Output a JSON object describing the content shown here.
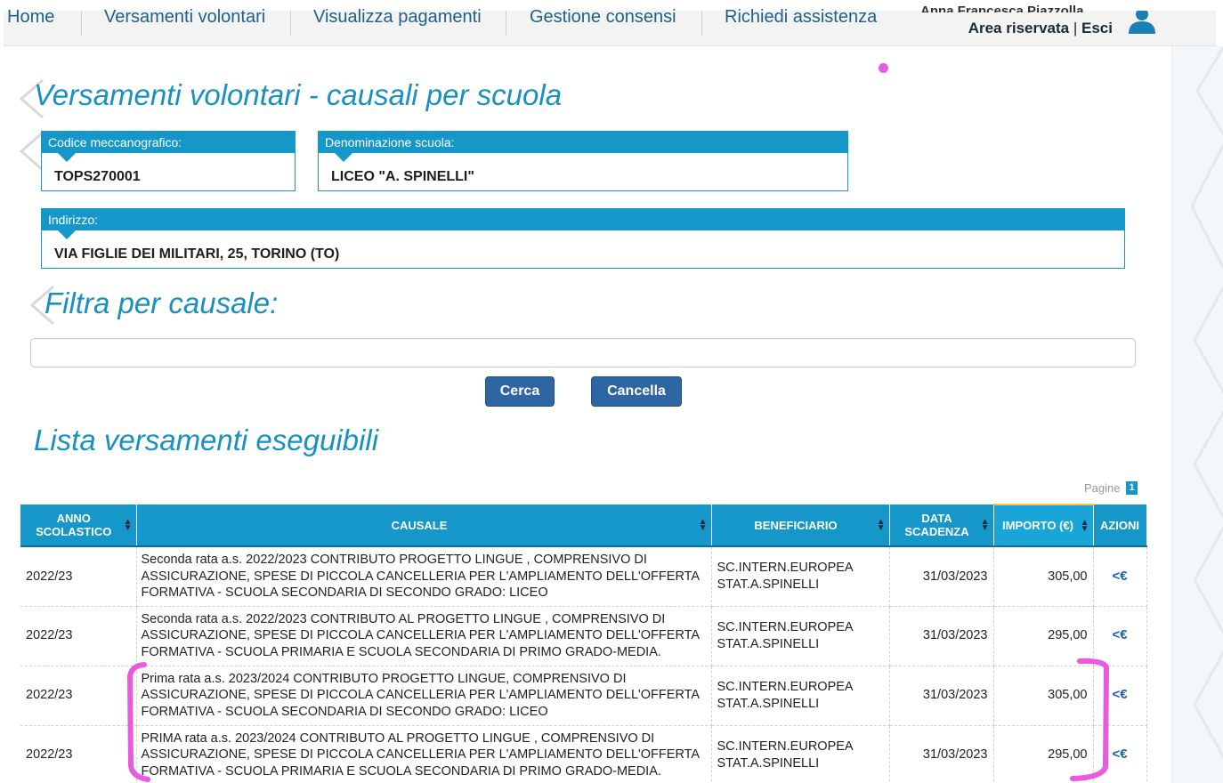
{
  "nav": {
    "items": [
      "Home",
      "Versamenti volontari",
      "Visualizza pagamenti",
      "Gestione consensi",
      "Richiedi assistenza"
    ],
    "user_name": "Anna Francesca Piazzolla",
    "area_riservata": "Area riservata",
    "separator": "|",
    "logout": "Esci"
  },
  "page": {
    "title": "Versamenti volontari - causali per scuola",
    "filter_title": "Filtra per causale:",
    "list_title": "Lista versamenti eseguibili"
  },
  "school": {
    "code_label": "Codice meccanografico:",
    "code_value": "TOPS270001",
    "name_label": "Denominazione scuola:",
    "name_value": "LICEO \"A. SPINELLI\"",
    "address_label": "Indirizzo:",
    "address_value": "VIA FIGLIE DEI MILITARI, 25, TORINO (TO)"
  },
  "filter": {
    "value": "",
    "placeholder": ""
  },
  "buttons": {
    "search": "Cerca",
    "cancel": "Cancella"
  },
  "pagination": {
    "label": "Pagine",
    "current": "1"
  },
  "table": {
    "headers": {
      "anno": [
        "ANNO",
        "SCOLASTICO"
      ],
      "causale": "CAUSALE",
      "beneficiario": "BENEFICIARIO",
      "scadenza": [
        "DATA",
        "SCADENZA"
      ],
      "importo": "IMPORTO (€)",
      "azioni": "AZIONI"
    },
    "rows": [
      {
        "anno": "2022/23",
        "causale": [
          "Seconda rata a.s. 2022/2023 CONTRIBUTO PROGETTO LINGUE , COMPRENSIVO DI",
          "ASSICURAZIONE, SPESE DI PICCOLA CANCELLERIA PER L'AMPLIAMENTO DELL'OFFERTA",
          "FORMATIVA - SCUOLA SECONDARIA DI SECONDO GRADO: LICEO"
        ],
        "beneficiario": [
          "SC.INTERN.EUROPEA",
          "STAT.A.SPINELLI"
        ],
        "scadenza": "31/03/2023",
        "importo": "305,00",
        "azione": "<€"
      },
      {
        "anno": "2022/23",
        "causale": [
          "Seconda rata a.s. 2022/2023 CONTRIBUTO AL PROGETTO LINGUE , COMPRENSIVO DI",
          "ASSICURAZIONE, SPESE DI PICCOLA CANCELLERIA PER L'AMPLIAMENTO DELL'OFFERTA",
          "FORMATIVA - SCUOLA PRIMARIA E SCUOLA SECONDARIA DI PRIMO GRADO-MEDIA."
        ],
        "beneficiario": [
          "SC.INTERN.EUROPEA",
          "STAT.A.SPINELLI"
        ],
        "scadenza": "31/03/2023",
        "importo": "295,00",
        "azione": "<€"
      },
      {
        "anno": "2022/23",
        "causale": [
          "Prima rata a.s. 2023/2024 CONTRIBUTO PROGETTO LINGUE, COMPRENSIVO DI",
          "ASSICURAZIONE, SPESE DI PICCOLA CANCELLERIA PER L'AMPLIAMENTO DELL'OFFERTA",
          "FORMATIVA - SCUOLA SECONDARIA DI SECONDO GRADO: LICEO"
        ],
        "beneficiario": [
          "SC.INTERN.EUROPEA",
          "STAT.A.SPINELLI"
        ],
        "scadenza": "31/03/2023",
        "importo": "305,00",
        "azione": "<€"
      },
      {
        "anno": "2022/23",
        "causale": [
          "PRIMA rata a.s. 2023/2024 CONTRIBUTO AL PROGETTO LINGUE , COMPRENSIVO DI",
          "ASSICURAZIONE, SPESE DI PICCOLA CANCELLERIA PER L'AMPLIAMENTO DELL'OFFERTA",
          "FORMATIVA - SCUOLA PRIMARIA E SCUOLA SECONDARIA DI PRIMO GRADO-MEDIA."
        ],
        "beneficiario": [
          "SC.INTERN.EUROPEA",
          "STAT.A.SPINELLI"
        ],
        "scadenza": "31/03/2023",
        "importo": "295,00",
        "azione": "<€"
      }
    ]
  },
  "icons": {
    "user": "user-icon",
    "sort": "sort-icon",
    "pay": "pay-icon"
  },
  "colors": {
    "accent": "#1597c9",
    "button": "#2e65a3",
    "title": "#1891c1",
    "annotation": "#e85ae0"
  }
}
